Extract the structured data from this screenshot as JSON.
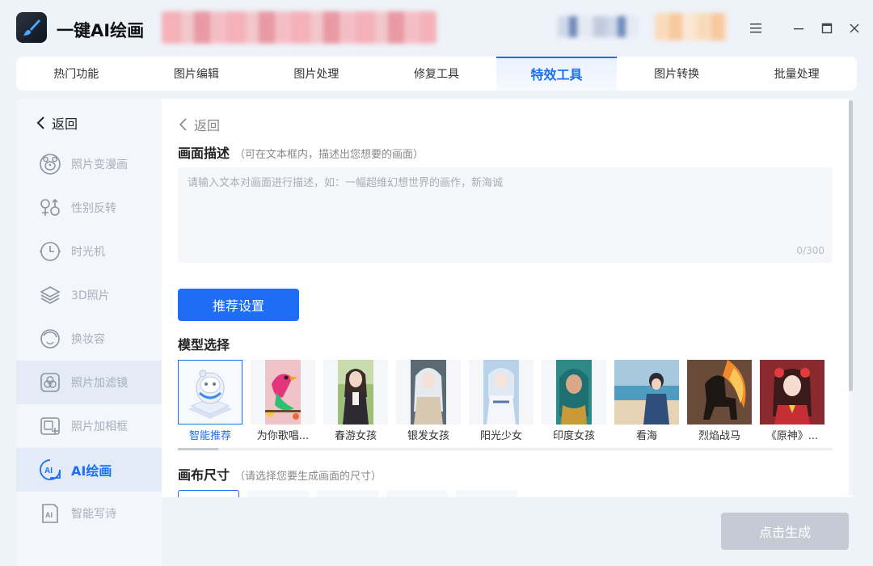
{
  "app": {
    "title": "一键AI绘画"
  },
  "tabs": [
    {
      "label": "热门功能"
    },
    {
      "label": "图片编辑"
    },
    {
      "label": "图片处理"
    },
    {
      "label": "修复工具"
    },
    {
      "label": "特效工具"
    },
    {
      "label": "图片转换"
    },
    {
      "label": "批量处理"
    }
  ],
  "active_tab": "特效工具",
  "sidebar": {
    "back_label": "返回",
    "items": [
      {
        "label": "照片变漫画",
        "icon": "bear-face-icon"
      },
      {
        "label": "性别反转",
        "icon": "gender-icon"
      },
      {
        "label": "时光机",
        "icon": "clock-icon"
      },
      {
        "label": "3D照片",
        "icon": "layers-icon"
      },
      {
        "label": "换妆容",
        "icon": "face-makeup-icon"
      },
      {
        "label": "照片加滤镜",
        "icon": "filter-icon"
      },
      {
        "label": "照片加相框",
        "icon": "frame-icon"
      },
      {
        "label": "AI绘画",
        "icon": "ai-badge-icon"
      },
      {
        "label": "智能写诗",
        "icon": "ai-document-icon"
      }
    ],
    "active_item": "AI绘画"
  },
  "main": {
    "back_label": "返回",
    "description": {
      "title": "画面描述",
      "hint": "（可在文本框内，描述出您想要的画面）",
      "placeholder": "请输入文本对画面进行描述，如：一幅超维幻想世界的画作，新海诚",
      "counter": "0/300"
    },
    "recommend_button": "推荐设置",
    "model": {
      "title": "模型选择",
      "items": [
        {
          "label": "智能推荐",
          "selected": true
        },
        {
          "label": "为你歌唱..."
        },
        {
          "label": "春游女孩"
        },
        {
          "label": "银发女孩"
        },
        {
          "label": "阳光少女"
        },
        {
          "label": "印度女孩"
        },
        {
          "label": "看海"
        },
        {
          "label": "烈焰战马"
        },
        {
          "label": "《原神》..."
        }
      ]
    },
    "canvas": {
      "title": "画布尺寸",
      "hint": "（请选择您要生成画面的尺寸）"
    }
  },
  "generate_button": "点击生成",
  "colors": {
    "accent": "#1d6ef5",
    "disabled": "#c5cbd4"
  }
}
